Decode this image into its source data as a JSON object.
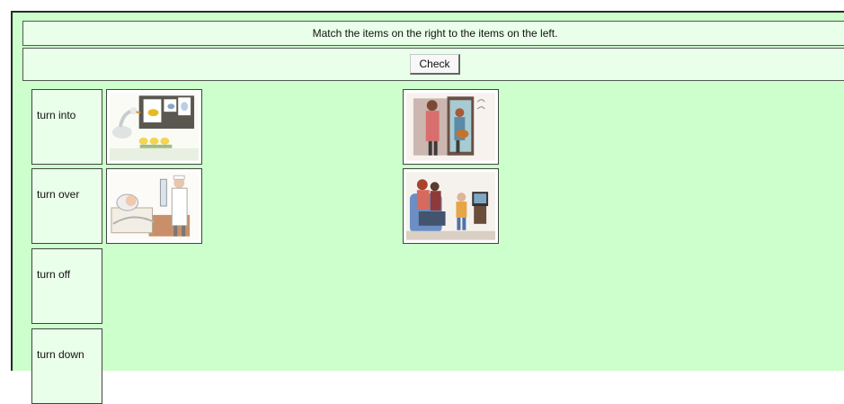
{
  "instruction": "Match the items on the right to the items on the left.",
  "check_button": "Check",
  "terms": [
    "turn into",
    "turn over",
    "turn off",
    "turn down"
  ],
  "pictures": [
    {
      "icon": "goose-lesson-picture"
    },
    {
      "icon": "family-doorway-picture"
    },
    {
      "icon": "nurse-patient-picture"
    },
    {
      "icon": "family-television-picture"
    }
  ]
}
